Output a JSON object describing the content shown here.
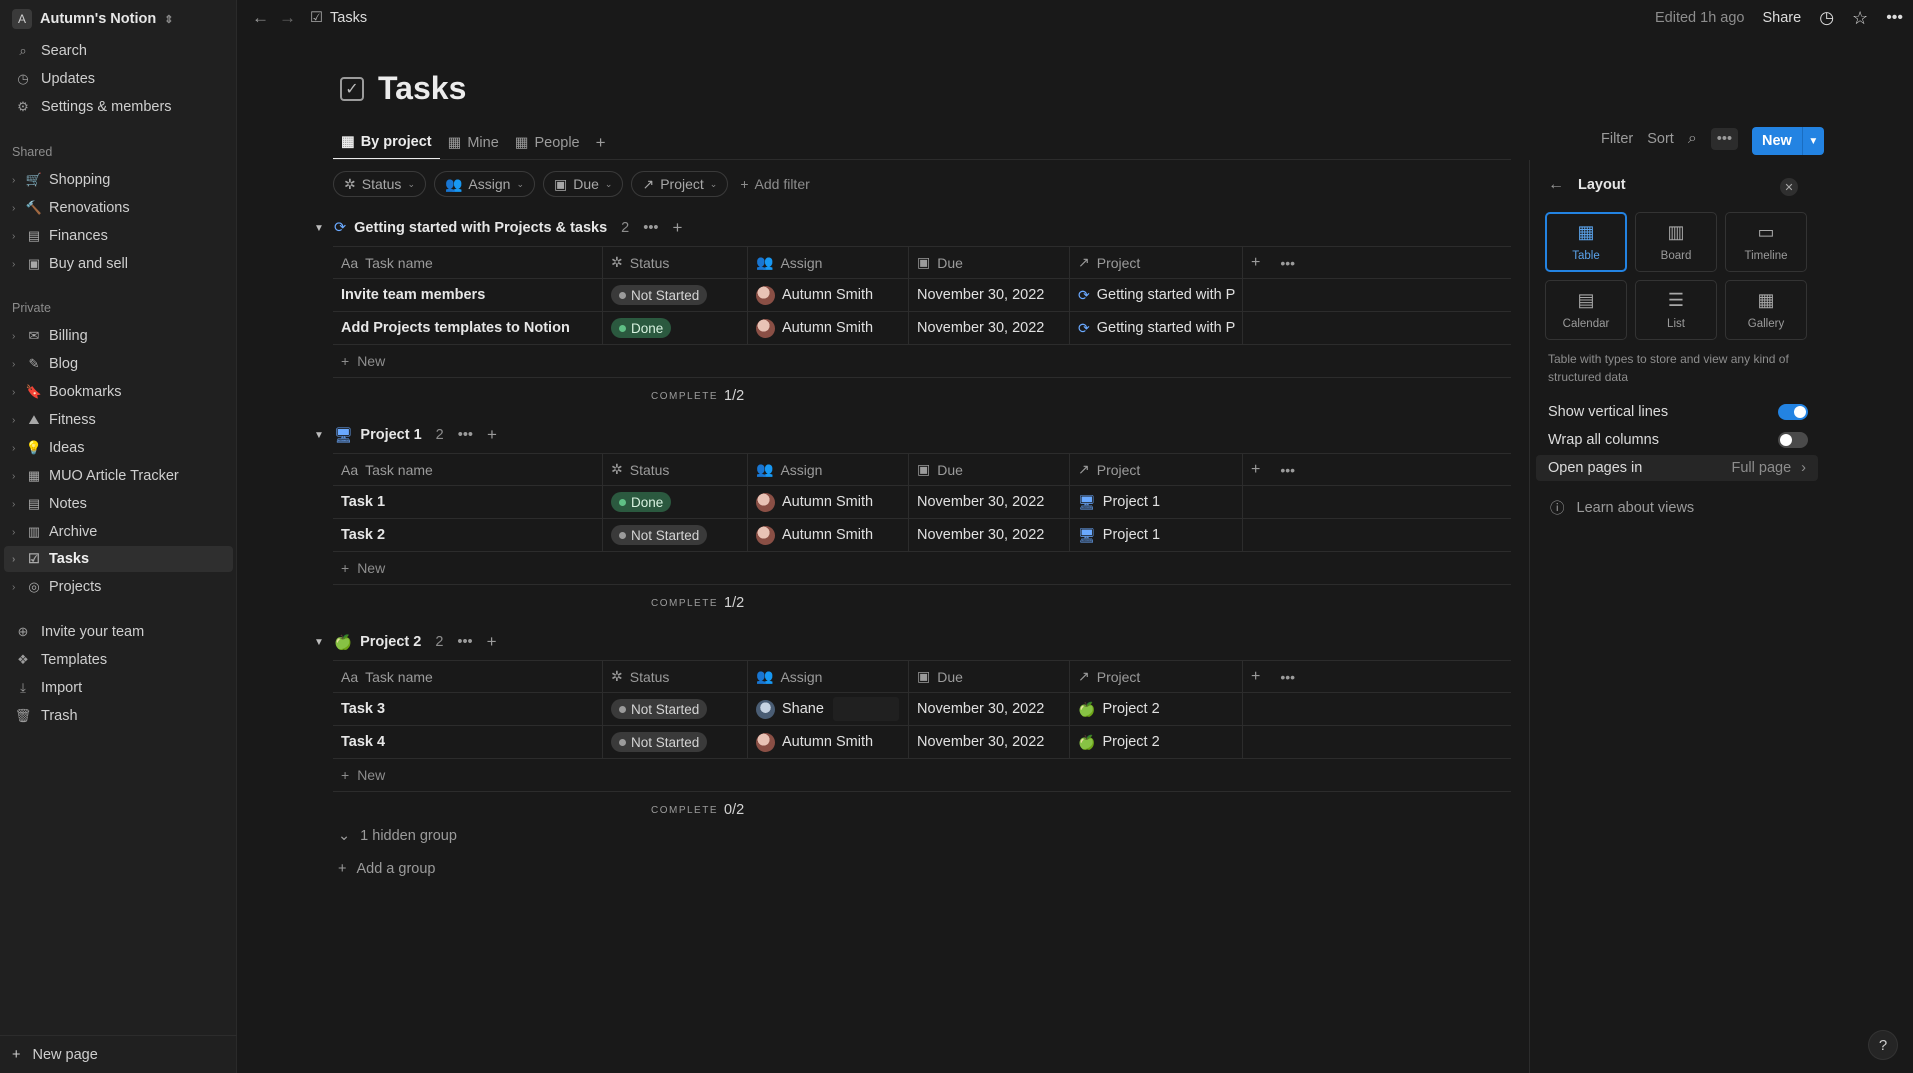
{
  "workspace": {
    "initial": "A",
    "name": "Autumn's Notion"
  },
  "sidebar": {
    "top": [
      {
        "icon": "search-icon",
        "glyph": "⌕",
        "label": "Search"
      },
      {
        "icon": "updates-icon",
        "glyph": "◷",
        "label": "Updates"
      },
      {
        "icon": "gear-icon",
        "glyph": "⚙",
        "label": "Settings & members"
      }
    ],
    "shared_title": "Shared",
    "shared": [
      {
        "glyph": "🛒",
        "label": "Shopping"
      },
      {
        "glyph": "🔨",
        "label": "Renovations"
      },
      {
        "glyph": "▤",
        "label": "Finances"
      },
      {
        "glyph": "▣",
        "label": "Buy and sell"
      }
    ],
    "private_title": "Private",
    "private": [
      {
        "glyph": "✉",
        "label": "Billing"
      },
      {
        "glyph": "✎",
        "label": "Blog"
      },
      {
        "glyph": "🔖",
        "label": "Bookmarks"
      },
      {
        "glyph": "⛰",
        "label": "Fitness"
      },
      {
        "glyph": "💡",
        "label": "Ideas"
      },
      {
        "glyph": "▦",
        "label": "MUO Article Tracker"
      },
      {
        "glyph": "▤",
        "label": "Notes"
      },
      {
        "glyph": "▥",
        "label": "Archive"
      },
      {
        "glyph": "☑",
        "label": "Tasks"
      },
      {
        "glyph": "◎",
        "label": "Projects"
      }
    ],
    "bottom": [
      {
        "glyph": "⊕",
        "label": "Invite your team"
      },
      {
        "glyph": "❖",
        "label": "Templates"
      },
      {
        "glyph": "⤓",
        "label": "Import"
      },
      {
        "glyph": "🗑",
        "label": "Trash"
      }
    ],
    "new_page": "New page"
  },
  "topbar": {
    "breadcrumb": "Tasks",
    "edited": "Edited 1h ago",
    "share": "Share"
  },
  "page": {
    "title": "Tasks"
  },
  "views": {
    "tabs": [
      "By project",
      "Mine",
      "People"
    ],
    "filter": "Filter",
    "sort": "Sort",
    "new": "New"
  },
  "filters": {
    "chips": [
      "Status",
      "Assign",
      "Due",
      "Project"
    ],
    "add": "Add filter"
  },
  "columns": {
    "name": "Task name",
    "status": "Status",
    "assign": "Assign",
    "due": "Due",
    "project": "Project"
  },
  "groups": [
    {
      "title": "Getting started with Projects & tasks",
      "icon": "⟳",
      "count": "2",
      "rows": [
        {
          "name": "Invite team members",
          "status": "Not Started",
          "assign": "Autumn Smith",
          "due": "November 30, 2022",
          "project": "Getting started with P"
        },
        {
          "name": "Add Projects templates to Notion",
          "status": "Done",
          "assign": "Autumn Smith",
          "due": "November 30, 2022",
          "project": "Getting started with P"
        }
      ],
      "complete": "1/2"
    },
    {
      "title": "Project 1",
      "icon": "🖥",
      "count": "2",
      "rows": [
        {
          "name": "Task 1",
          "status": "Done",
          "assign": "Autumn Smith",
          "due": "November 30, 2022",
          "project": "Project 1"
        },
        {
          "name": "Task 2",
          "status": "Not Started",
          "assign": "Autumn Smith",
          "due": "November 30, 2022",
          "project": "Project 1"
        }
      ],
      "complete": "1/2"
    },
    {
      "title": "Project 2",
      "icon": "🍏",
      "count": "2",
      "rows": [
        {
          "name": "Task 3",
          "status": "Not Started",
          "assign": "Shane",
          "due": "November 30, 2022",
          "project": "Project 2"
        },
        {
          "name": "Task 4",
          "status": "Not Started",
          "assign": "Autumn Smith",
          "due": "November 30, 2022",
          "project": "Project 2"
        }
      ],
      "complete": "0/2"
    }
  ],
  "new_row_label": "New",
  "complete_label": "COMPLETE",
  "hidden_group": "1 hidden group",
  "add_group": "Add a group",
  "layout_panel": {
    "title": "Layout",
    "options": [
      "Table",
      "Board",
      "Timeline",
      "Calendar",
      "List",
      "Gallery"
    ],
    "selected": "Table",
    "description": "Table with types to store and view any kind of structured data",
    "show_vertical_lines": "Show vertical lines",
    "wrap_columns": "Wrap all columns",
    "open_pages_in": "Open pages in",
    "open_pages_value": "Full page",
    "learn": "Learn about views"
  },
  "colors": {
    "accent": "#2383e2",
    "done_bg": "#2b593f",
    "bg": "#191919",
    "sidebar_bg": "#202020"
  }
}
